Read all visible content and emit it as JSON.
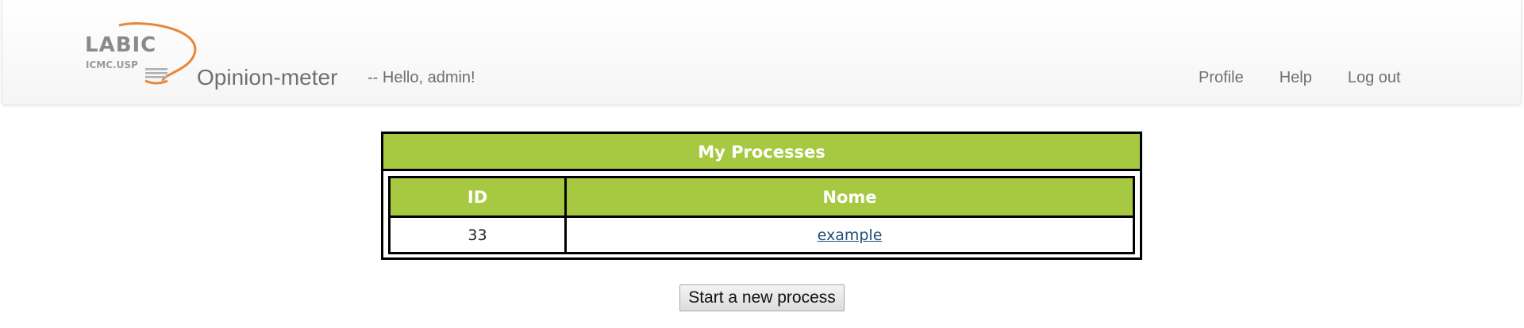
{
  "logo": {
    "main_text": "LABIC",
    "sub_text_a": "ICMC",
    "sub_text_b": "USP"
  },
  "brand": "Opinion-meter",
  "greeting": "-- Hello, admin!",
  "nav": {
    "profile": "Profile",
    "help": "Help",
    "logout": "Log out"
  },
  "processes": {
    "title": "My Processes",
    "columns": [
      "ID",
      "Nome"
    ],
    "rows": [
      {
        "id": "33",
        "name": "example"
      }
    ]
  },
  "new_process_button": "Start a new process",
  "colors": {
    "header_green": "#a6c941",
    "logo_orange": "#e8873a",
    "nav_text": "#707070"
  }
}
